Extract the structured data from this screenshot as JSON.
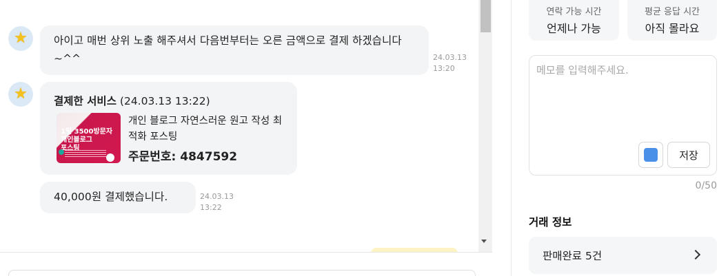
{
  "chat": {
    "messages": [
      {
        "text": "아이고 매번 상위 노출 해주셔서 다음번부터는 오른 금액으로 결제 하겠습니다~^^",
        "date": "24.03.13",
        "time": "13:20"
      },
      {
        "service_title": "결제한 서비스",
        "service_datetime": "(24.03.13 13:22)",
        "thumbnail_lines": [
          "1일 3500방문자",
          "개인블로그",
          "포스팅"
        ],
        "service_name": "개인 블로그 자연스러운 원고 작성 최적화 포스팅",
        "order_label": "주문번호: 4847592"
      },
      {
        "text": "40,000원 결제했습니다.",
        "date": "24.03.13",
        "time": "13:22"
      }
    ]
  },
  "info": {
    "contact_label": "연락 가능 시간",
    "contact_value": "언제나 가능",
    "response_label": "평균 응답 시간",
    "response_value": "아직 몰라요"
  },
  "memo": {
    "placeholder": "메모를 입력해주세요.",
    "save_label": "저장",
    "counter": "0/50",
    "color": "#4a90e8"
  },
  "trade": {
    "title": "거래 정보",
    "sold_label": "판매완료 5건"
  }
}
